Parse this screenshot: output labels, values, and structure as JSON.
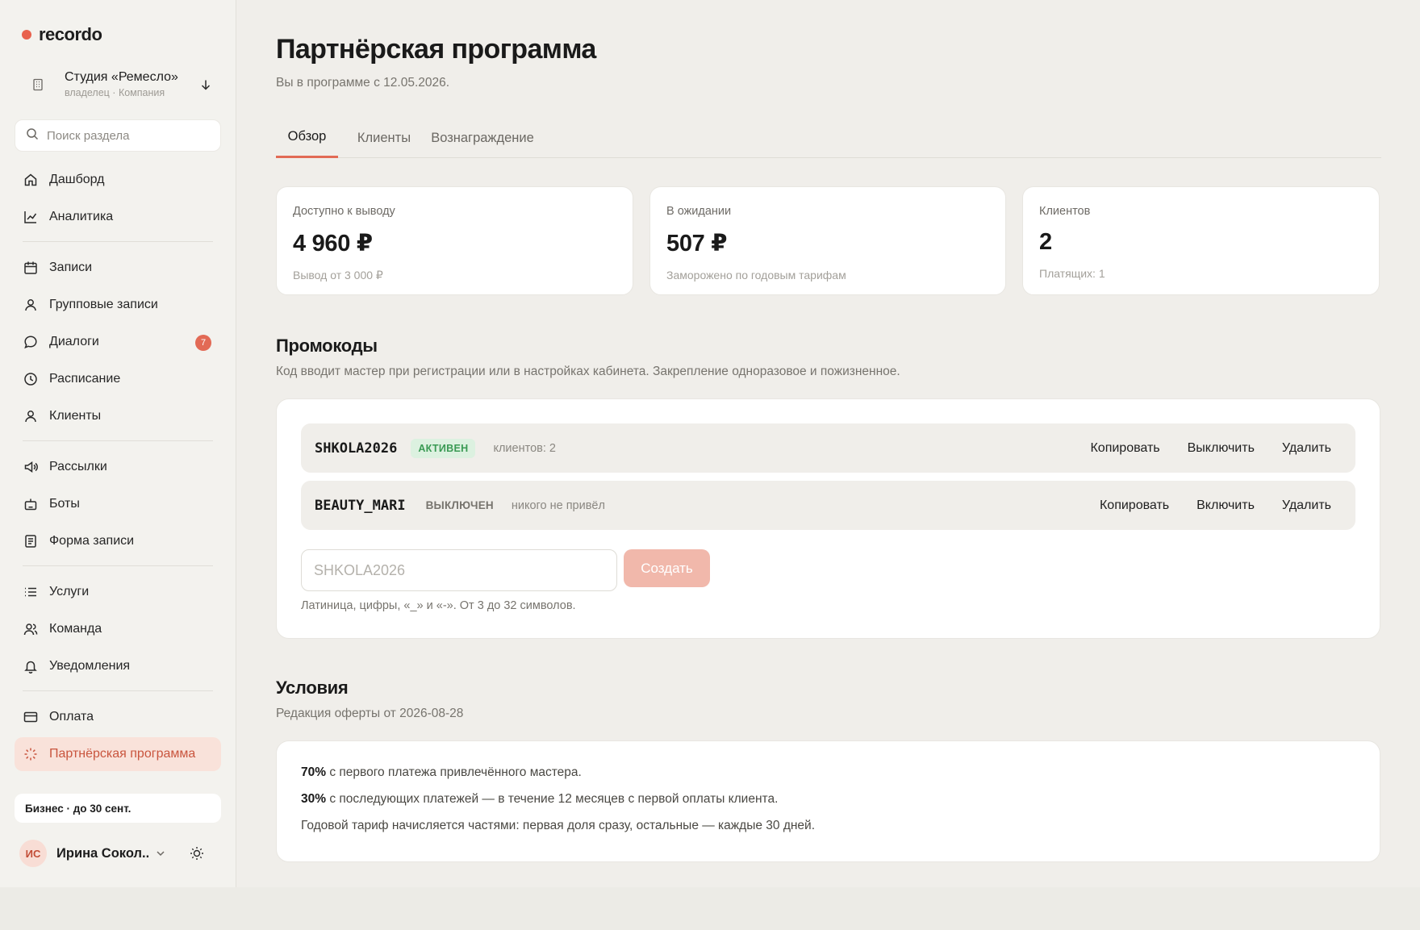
{
  "app": {
    "logo": "recordo"
  },
  "org": {
    "name": "Студия «Ремесло»",
    "role": "владелец · Компания"
  },
  "search": {
    "placeholder": "Поиск раздела"
  },
  "nav": [
    {
      "label": "Дашборд",
      "icon": "home-icon"
    },
    {
      "label": "Аналитика",
      "icon": "chart-icon"
    },
    {
      "label": "Записи",
      "icon": "calendar-icon"
    },
    {
      "label": "Групповые записи",
      "icon": "user-icon"
    },
    {
      "label": "Диалоги",
      "icon": "chat-icon",
      "badge": "7"
    },
    {
      "label": "Расписание",
      "icon": "clock-icon"
    },
    {
      "label": "Клиенты",
      "icon": "user-icon"
    },
    {
      "label": "Рассылки",
      "icon": "megaphone-icon"
    },
    {
      "label": "Боты",
      "icon": "bot-icon"
    },
    {
      "label": "Форма записи",
      "icon": "form-icon"
    },
    {
      "label": "Услуги",
      "icon": "list-icon"
    },
    {
      "label": "Команда",
      "icon": "team-icon"
    },
    {
      "label": "Уведомления",
      "icon": "bell-icon"
    },
    {
      "label": "Оплата",
      "icon": "card-icon"
    },
    {
      "label": "Партнёрская программа",
      "icon": "sparkle-icon",
      "active": true
    }
  ],
  "plan": {
    "label": "Бизнес · до 30 сент."
  },
  "user": {
    "initials": "ИС",
    "name": "Ирина Сокол..."
  },
  "page": {
    "title": "Партнёрская программа",
    "subtitle": "Вы в программе с 12.05.2026."
  },
  "tabs": [
    "Обзор",
    "Клиенты",
    "Вознаграждение"
  ],
  "stats": [
    {
      "label": "Доступно к выводу",
      "value": "4 960 ₽",
      "note": "Вывод от 3 000 ₽"
    },
    {
      "label": "В ожидании",
      "value": "507 ₽",
      "note": "Заморожено по годовым тарифам"
    },
    {
      "label": "Клиентов",
      "value": "2",
      "note": "Платящих: 1"
    }
  ],
  "promo": {
    "title": "Промокоды",
    "subtitle": "Код вводит мастер при регистрации или в настройках кабинета. Закрепление одноразовое и пожизненное.",
    "rows": [
      {
        "code": "SHKOLA2026",
        "status": "АКТИВЕН",
        "meta": "клиентов: 2",
        "actions": [
          "Копировать",
          "Выключить",
          "Удалить"
        ]
      },
      {
        "code": "BEAUTY_MARI",
        "status": "ВЫКЛЮЧЕН",
        "meta": "никого не привёл",
        "actions": [
          "Копировать",
          "Включить",
          "Удалить"
        ]
      }
    ],
    "input_placeholder": "SHKOLA2026",
    "create_label": "Создать",
    "hint": "Латиница, цифры, «_» и «-». От 3 до 32 символов."
  },
  "terms": {
    "title": "Условия",
    "subtitle": "Редакция оферты от 2026-08-28",
    "lines": [
      {
        "strong": "70%",
        "text": " с первого платежа привлечённого мастера."
      },
      {
        "strong": "30%",
        "text": " с последующих платежей — в течение 12 месяцев с первой оплаты клиента."
      },
      {
        "strong": "",
        "text": "Годовой тариф начисляется частями: первая доля сразу, остальные — каждые 30 дней."
      }
    ]
  },
  "colors": {
    "accent": "#e26a55",
    "background": "#f0eeea",
    "active_badge": "#dcf1e0"
  }
}
